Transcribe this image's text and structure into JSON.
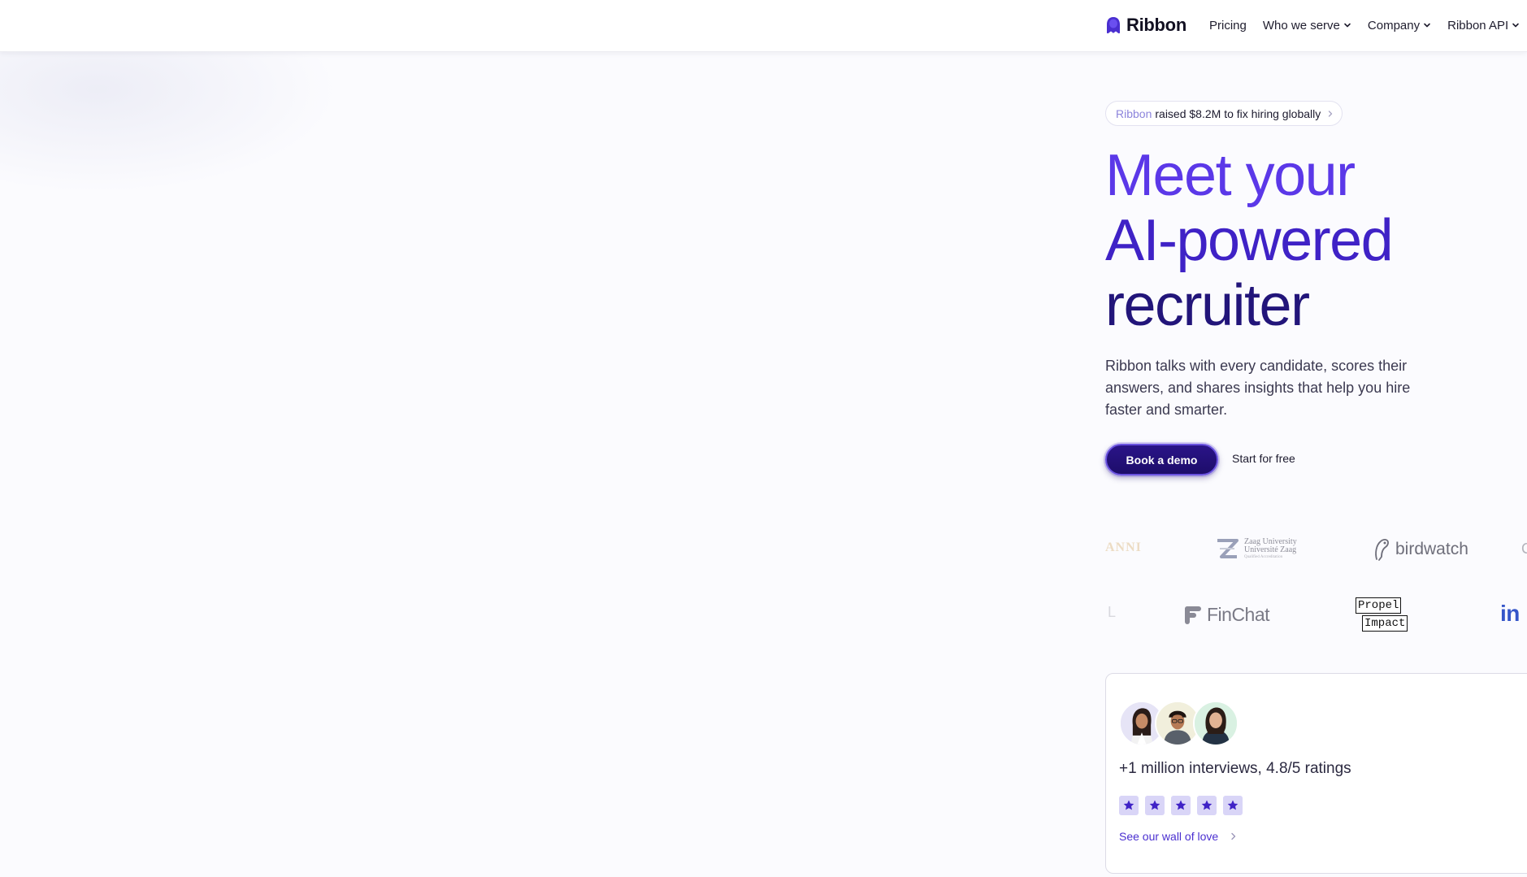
{
  "header": {
    "brand": "Ribbon",
    "nav": [
      {
        "label": "Pricing",
        "has_dropdown": false
      },
      {
        "label": "Who we serve",
        "has_dropdown": true
      },
      {
        "label": "Company",
        "has_dropdown": true
      },
      {
        "label": "Ribbon API",
        "has_dropdown": true
      }
    ]
  },
  "announcement": {
    "brand": "Ribbon",
    "text": "raised $8.2M to fix hiring globally"
  },
  "hero": {
    "title_lines": [
      "Meet your",
      "AI-powered",
      "recruiter"
    ],
    "subtitle": "Ribbon talks with every candidate, scores their answers, and shares insights that help you hire faster and smarter.",
    "primary_cta": "Book a demo",
    "secondary_cta": "Start for free"
  },
  "logos": {
    "row1": [
      {
        "name": "faded-logo",
        "text": "ANNI"
      },
      {
        "name": "zaag-university",
        "text": "Zaag University",
        "text2": "Université Zaag",
        "text3": "Qualified Accreditation"
      },
      {
        "name": "birdwatch",
        "text": "birdwatch"
      },
      {
        "name": "partial-logo",
        "text": "C"
      }
    ],
    "row2": [
      {
        "name": "partial-logo",
        "text": "L"
      },
      {
        "name": "finchat",
        "text": "FinChat"
      },
      {
        "name": "propel-impact",
        "text": "Propel",
        "text2": "Impact"
      },
      {
        "name": "indeed",
        "text": "in"
      }
    ]
  },
  "ratings": {
    "headline": "+1 million interviews, 4.8/5 ratings",
    "stars": 5,
    "link": "See our wall of love"
  },
  "colors": {
    "accent": "#5b38e8",
    "primary_button": "#1d0d6a",
    "star_bg": "#d9d5f7",
    "star_fill": "#3f22c6"
  }
}
